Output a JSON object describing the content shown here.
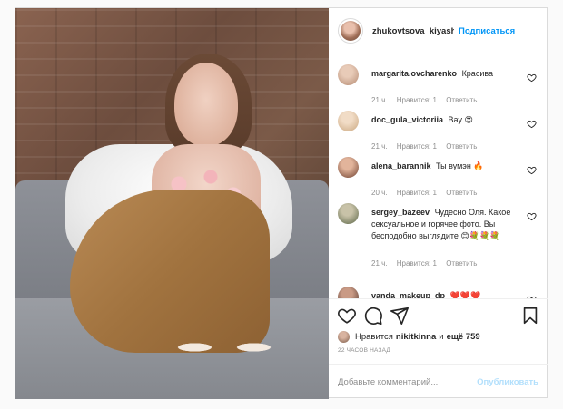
{
  "header": {
    "username": "zhukovtsova_kiyash",
    "follow_label": "Подписаться"
  },
  "comments": [
    {
      "user": "margarita.ovcharenko",
      "text": "Красива",
      "time": "21 ч.",
      "likes": "Нравится: 1",
      "reply": "Ответить",
      "avatar_color": "#c9a48e"
    },
    {
      "user": "doc_gula_victoriia",
      "text": "Вау 😍",
      "time": "21 ч.",
      "likes": "Нравится: 1",
      "reply": "Ответить",
      "avatar_color": "#d7b99a"
    },
    {
      "user": "alena_barannik",
      "text": "Ты вумэн 🔥",
      "time": "20 ч.",
      "likes": "Нравится: 1",
      "reply": "Ответить",
      "avatar_color": "#8a5a46"
    },
    {
      "user": "sergey_bazeev",
      "text": "Чудесно Оля. Какое сексуальное и горячее фото. Вы бесподобно выглядите 😊💐💐💐",
      "time": "21 ч.",
      "likes": "Нравится: 1",
      "reply": "Ответить",
      "avatar_color": "#6f7a5a"
    },
    {
      "user": "vanda_makeup_dp",
      "text": "❤️❤️❤️",
      "time": "",
      "likes": "",
      "reply": "",
      "avatar_color": "#5a4036"
    }
  ],
  "likes": {
    "prefix": "Нравится",
    "user": "nikitkinna",
    "conjunction": "и",
    "more": "ещё 759"
  },
  "time_ago": "22 ЧАСОВ НАЗАД",
  "comment_input": {
    "placeholder": "Добавьте комментарий...",
    "value": ""
  },
  "post_button": "Опубликовать",
  "icons": {
    "like": "heart-icon",
    "comment": "comment-icon",
    "share": "share-icon",
    "save": "bookmark-icon"
  }
}
